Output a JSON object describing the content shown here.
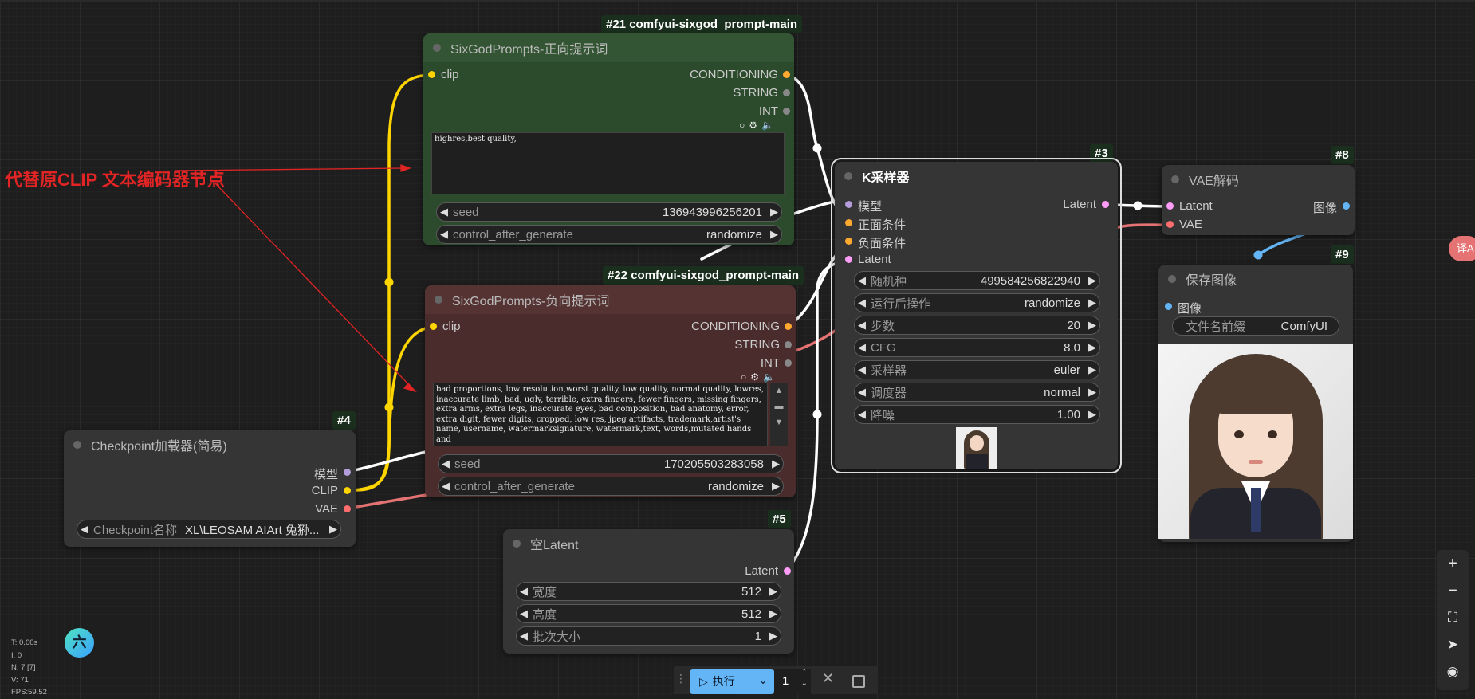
{
  "annotation": "代替原CLIP 文本编码器节点",
  "stats": [
    "T: 0.00s",
    "I: 0",
    "N: 7 [7]",
    "V: 71",
    "FPS:59.52"
  ],
  "logo": "六",
  "translate_btn": "译A",
  "colors": {
    "wire_white": "#ffffff",
    "wire_yellow": "#ffd500",
    "wire_red": "#e57373",
    "wire_blue": "#64b5f6",
    "annotation_red": "#e22424"
  },
  "nodes": {
    "pos": {
      "id": "#21 comfyui-sixgod_prompt-main",
      "title": "SixGodPrompts-正向提示词",
      "input": "clip",
      "outputs": [
        "CONDITIONING",
        "STRING",
        "INT"
      ],
      "icons": [
        "circle-icon",
        "gear-icon",
        "speaker-icon"
      ],
      "text": "highres,best quality,",
      "widgets": [
        {
          "label": "seed",
          "value": "136943996256201"
        },
        {
          "label": "control_after_generate",
          "value": "randomize"
        }
      ]
    },
    "neg": {
      "id": "#22 comfyui-sixgod_prompt-main",
      "title": "SixGodPrompts-负向提示词",
      "input": "clip",
      "outputs": [
        "CONDITIONING",
        "STRING",
        "INT"
      ],
      "icons": [
        "circle-icon",
        "gear-icon",
        "speaker-icon"
      ],
      "text": "bad proportions, low resolution,worst quality, low quality, normal quality, lowres,  inaccurate limb, bad, ugly, terrible,  extra fingers, fewer fingers, missing fingers, extra arms, extra legs, inaccurate eyes, bad composition, bad anatomy, error, extra digit, fewer digits, cropped, low res, jpeg artifacts, trademark,artist's name, username, watermarksignature, watermark,text, words,mutated hands and",
      "widgets": [
        {
          "label": "seed",
          "value": "170205503283058"
        },
        {
          "label": "control_after_generate",
          "value": "randomize"
        }
      ]
    },
    "ckpt": {
      "id": "#4",
      "title": "Checkpoint加载器(简易)",
      "outputs": [
        "模型",
        "CLIP",
        "VAE"
      ],
      "widget": {
        "label": "Checkpoint名称",
        "value": "XL\\LEOSAM AIArt 兔狲..."
      }
    },
    "latent": {
      "id": "#5",
      "title": "空Latent",
      "output": "Latent",
      "widgets": [
        {
          "label": "宽度",
          "value": "512"
        },
        {
          "label": "高度",
          "value": "512"
        },
        {
          "label": "批次大小",
          "value": "1"
        }
      ]
    },
    "ksampler": {
      "id": "#3",
      "title": "K采样器",
      "inputs": [
        "模型",
        "正面条件",
        "负面条件",
        "Latent"
      ],
      "output": "Latent",
      "widgets": [
        {
          "label": "随机种",
          "value": "499584256822940"
        },
        {
          "label": "运行后操作",
          "value": "randomize"
        },
        {
          "label": "步数",
          "value": "20"
        },
        {
          "label": "CFG",
          "value": "8.0"
        },
        {
          "label": "采样器",
          "value": "euler"
        },
        {
          "label": "调度器",
          "value": "normal"
        },
        {
          "label": "降噪",
          "value": "1.00"
        }
      ]
    },
    "vae": {
      "id": "#8",
      "title": "VAE解码",
      "inputs": [
        "Latent",
        "VAE"
      ],
      "output": "图像"
    },
    "save": {
      "id": "#9",
      "title": "保存图像",
      "input": "图像",
      "widget": {
        "label": "文件名前缀",
        "value": "ComfyUI"
      }
    }
  },
  "runbar": {
    "run_label": "执行",
    "count": "1"
  },
  "right_toolbar": [
    "plus-icon",
    "minus-icon",
    "fit-view-icon",
    "locate-icon",
    "eye-icon"
  ]
}
